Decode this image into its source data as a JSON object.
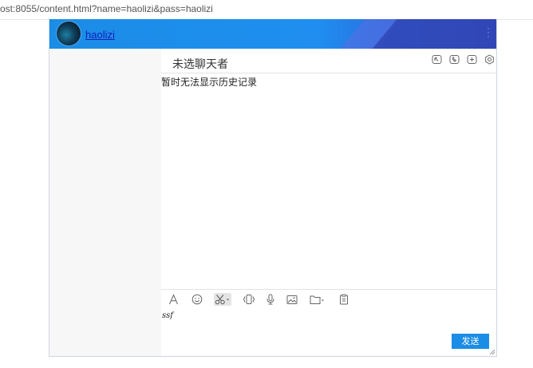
{
  "browser": {
    "url": "ost:8055/content.html?name=haolizi&pass=haolizi"
  },
  "header": {
    "username": "haolizi",
    "colors": {
      "start": "#1a8de6",
      "end": "#3146b6"
    }
  },
  "chat": {
    "title": "未选聊天者",
    "history_message": "暂时无法显示历史记录",
    "title_icons": [
      "screen-share-icon",
      "phone-icon",
      "add-icon",
      "settings-icon"
    ],
    "toolbar_icons": [
      "font-icon",
      "emoji-icon",
      "screenshot-icon",
      "shake-icon",
      "microphone-icon",
      "image-icon",
      "folder-icon",
      "clipboard-icon"
    ],
    "input_value": "ssf",
    "send_label": "发送",
    "accent": "#1a8de6"
  }
}
